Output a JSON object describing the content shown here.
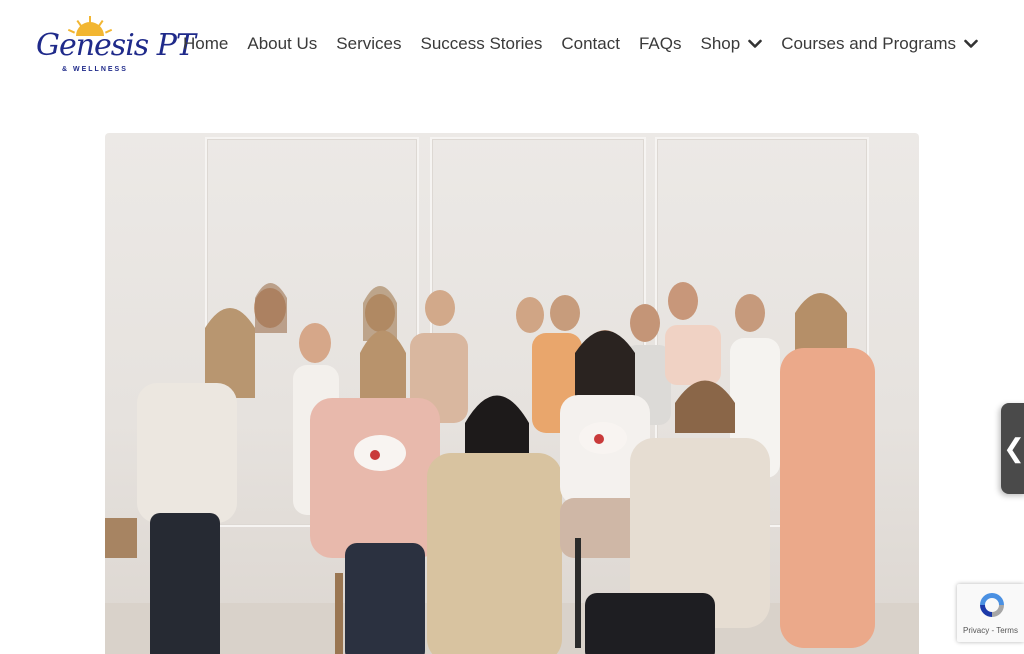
{
  "brand": {
    "name": "Genesis PT",
    "tagline": "& WELLNESS"
  },
  "nav": {
    "items": [
      {
        "label": "Home",
        "dropdown": false
      },
      {
        "label": "About Us",
        "dropdown": false
      },
      {
        "label": "Services",
        "dropdown": false
      },
      {
        "label": "Success Stories",
        "dropdown": false
      },
      {
        "label": "Contact",
        "dropdown": false
      },
      {
        "label": "FAQs",
        "dropdown": false
      },
      {
        "label": "Shop",
        "dropdown": true
      },
      {
        "label": "Courses and Programs",
        "dropdown": true
      }
    ]
  },
  "side_tab": {
    "icon": "chevron-left-icon",
    "glyph": "❮"
  },
  "recaptcha": {
    "links": "Privacy - Terms"
  },
  "colors": {
    "logo_blue": "#1f2a8a",
    "sun_yellow": "#f2b632"
  }
}
